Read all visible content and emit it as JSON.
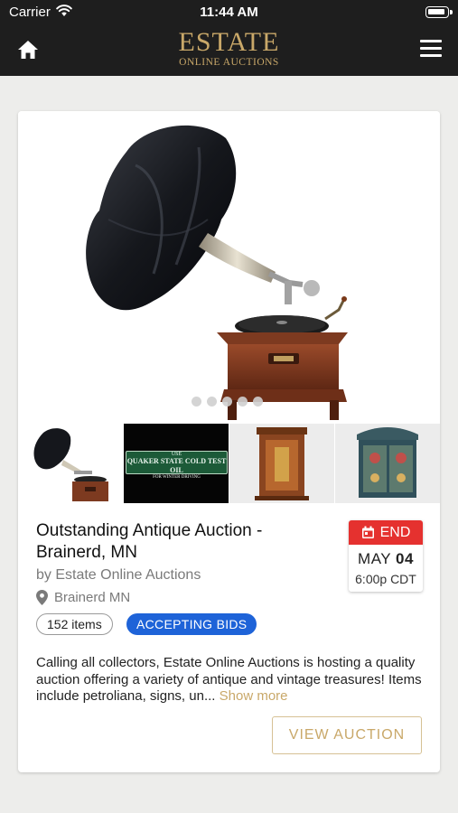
{
  "status_bar": {
    "carrier": "Carrier",
    "time": "11:44 AM"
  },
  "header": {
    "logo_main": "ESTATE",
    "logo_sub": "ONLINE AUCTIONS"
  },
  "auction": {
    "title": "Outstanding Antique Auction - Brainerd, MN",
    "byline": "by Estate Online Auctions",
    "location": "Brainerd MN",
    "end_label": "END",
    "end_month": "MAY",
    "end_day": "04",
    "end_time": "6:00p CDT",
    "items_count": "152 items",
    "status": "ACCEPTING BIDS",
    "description": "Calling all collectors, Estate Online Auctions is hosting a quality auction offering a variety of antique and vintage treasures! Items include petroliana, signs, un...",
    "show_more": "Show more",
    "view_button": "VIEW AUCTION",
    "thumb_sign_line1": "USE",
    "thumb_sign_line2": "QUAKER STATE COLD TEST OIL",
    "thumb_sign_line3": "FOR WINTER DRIVING"
  },
  "carousel": {
    "total_slides": 5,
    "active_slide": 1
  },
  "colors": {
    "header_bg": "#1e1e1e",
    "gold": "#c9a869",
    "end_red": "#e5312f",
    "status_blue": "#1e63d8"
  }
}
